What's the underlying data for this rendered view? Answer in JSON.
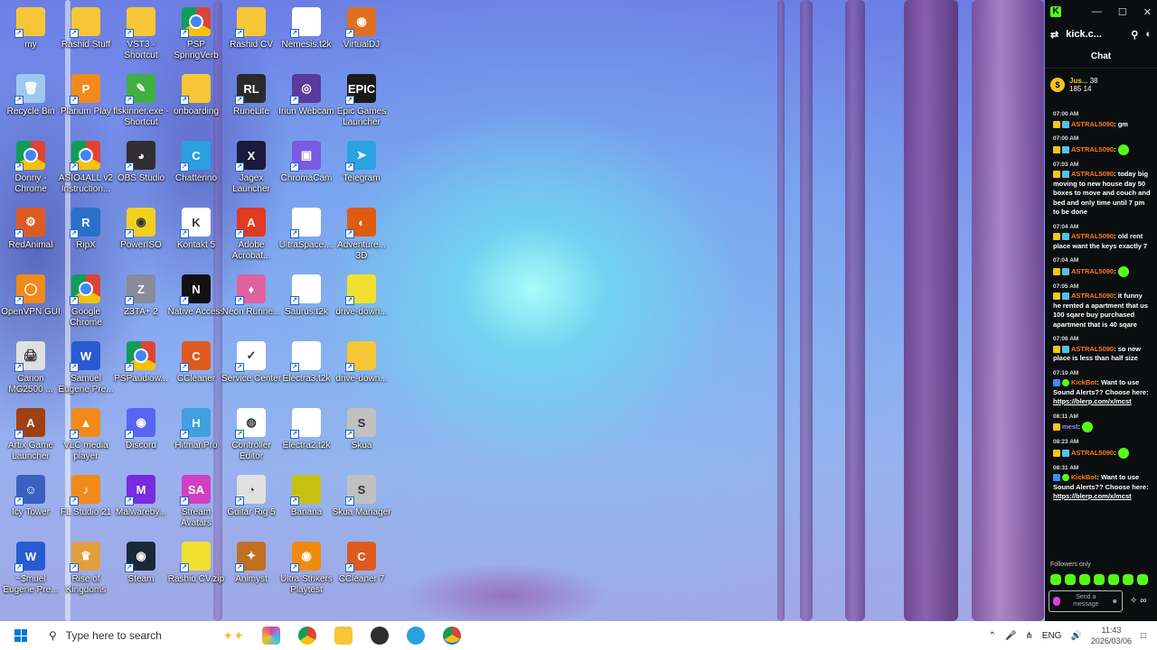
{
  "desktop": {
    "icons": [
      {
        "label": "my",
        "kind": "folder",
        "color": "#f6c636"
      },
      {
        "label": "Rashid Stuff",
        "kind": "folder",
        "color": "#f6c636"
      },
      {
        "label": "VST3 - Shortcut",
        "kind": "folder",
        "color": "#f6c636"
      },
      {
        "label": "PSP SpringVerb",
        "kind": "chrome",
        "color": "#4285f4"
      },
      {
        "label": "Rashid CV",
        "kind": "folder",
        "color": "#f6c636"
      },
      {
        "label": "Nemesis.t2k",
        "kind": "doc",
        "color": "#ffffff"
      },
      {
        "label": "VirtualDJ",
        "kind": "app",
        "color": "#e07020",
        "glyph": "◉"
      },
      {
        "label": "Recycle Bin",
        "kind": "app",
        "color": "#9fc8ee",
        "glyph": "🗑"
      },
      {
        "label": "Plarium Play",
        "kind": "app",
        "color": "#f08a1a",
        "glyph": "P"
      },
      {
        "label": "flskinner.exe - Shortcut",
        "kind": "app",
        "color": "#40b040",
        "glyph": "✎"
      },
      {
        "label": "onboarding",
        "kind": "folder",
        "color": "#f6c636"
      },
      {
        "label": "RuneLite",
        "kind": "app",
        "color": "#2a2a2a",
        "glyph": "RL"
      },
      {
        "label": "Iriun Webcam",
        "kind": "app",
        "color": "#5a3a9a",
        "glyph": "◎"
      },
      {
        "label": "Epic Games Launcher",
        "kind": "app",
        "color": "#1a1a1a",
        "glyph": "EPIC"
      },
      {
        "label": "Donny - Chrome",
        "kind": "chrome",
        "color": "#4285f4"
      },
      {
        "label": "ASIO4ALL v2 Instruction...",
        "kind": "chrome",
        "color": "#4285f4"
      },
      {
        "label": "OBS Studio",
        "kind": "app",
        "color": "#302e31",
        "glyph": "◕"
      },
      {
        "label": "Chatterino",
        "kind": "app",
        "color": "#2aa0e0",
        "glyph": "C"
      },
      {
        "label": "Jagex Launcher",
        "kind": "app",
        "color": "#1a1a3a",
        "glyph": "X"
      },
      {
        "label": "ChromaCam",
        "kind": "app",
        "color": "#7a5ae0",
        "glyph": "▣"
      },
      {
        "label": "Telegram",
        "kind": "app",
        "color": "#2aa3e0",
        "glyph": "➤"
      },
      {
        "label": "RedAnimal",
        "kind": "app",
        "color": "#e05a20",
        "glyph": "⚙"
      },
      {
        "label": "RipX",
        "kind": "app",
        "color": "#2a70c8",
        "glyph": "R"
      },
      {
        "label": "PowerISO",
        "kind": "app",
        "color": "#f2d020",
        "glyph": "◉"
      },
      {
        "label": "Kontakt 5",
        "kind": "app",
        "color": "#ffffff",
        "glyph": "K"
      },
      {
        "label": "Adobe Acrobat...",
        "kind": "app",
        "color": "#e03a20",
        "glyph": "A"
      },
      {
        "label": "UltraSpace....",
        "kind": "doc",
        "color": "#ffffff"
      },
      {
        "label": "Adventure... 3D",
        "kind": "app",
        "color": "#e05a10",
        "glyph": "◐"
      },
      {
        "label": "OpenVPN GUI",
        "kind": "app",
        "color": "#f08a1a",
        "glyph": "◯"
      },
      {
        "label": "Google Chrome",
        "kind": "chrome",
        "color": "#4285f4"
      },
      {
        "label": "Z3TA+ 2",
        "kind": "app",
        "color": "#8a8a9a",
        "glyph": "Z"
      },
      {
        "label": "Native Access",
        "kind": "app",
        "color": "#111111",
        "glyph": "N"
      },
      {
        "label": "Neon Runne...",
        "kind": "app",
        "color": "#e060a0",
        "glyph": "♦"
      },
      {
        "label": "Saurus.t2k",
        "kind": "doc",
        "color": "#ffffff"
      },
      {
        "label": "drive-down...",
        "kind": "folder",
        "color": "#f2e030"
      },
      {
        "label": "Canon MG2500 ...",
        "kind": "app",
        "color": "#e0e0e0",
        "glyph": "🖨"
      },
      {
        "label": "Samuel Eugene Pre...",
        "kind": "app",
        "color": "#2a5ad0",
        "glyph": "W"
      },
      {
        "label": "PSPaudiow...",
        "kind": "chrome",
        "color": "#4285f4"
      },
      {
        "label": "CCleaner",
        "kind": "app",
        "color": "#e05a20",
        "glyph": "C"
      },
      {
        "label": "Service Center",
        "kind": "app",
        "color": "#ffffff",
        "glyph": "✓"
      },
      {
        "label": "Electra3.t2k",
        "kind": "doc",
        "color": "#ffffff"
      },
      {
        "label": "drive-down...",
        "kind": "folder",
        "color": "#f6c636"
      },
      {
        "label": "Artix Game Launcher",
        "kind": "app",
        "color": "#a04010",
        "glyph": "A"
      },
      {
        "label": "VLC media player",
        "kind": "app",
        "color": "#f08a1a",
        "glyph": "▲"
      },
      {
        "label": "Discord",
        "kind": "app",
        "color": "#5865f2",
        "glyph": "◉"
      },
      {
        "label": "HitmanPro",
        "kind": "app",
        "color": "#40a0e0",
        "glyph": "H"
      },
      {
        "label": "Controller Editor",
        "kind": "app",
        "color": "#ffffff",
        "glyph": "◍"
      },
      {
        "label": "Electra2.t2k",
        "kind": "doc",
        "color": "#ffffff"
      },
      {
        "label": "Skua",
        "kind": "app",
        "color": "#c0c0c0",
        "glyph": "S"
      },
      {
        "label": "Icy Tower",
        "kind": "app",
        "color": "#3a60c0",
        "glyph": "☺"
      },
      {
        "label": "FL Studio 21",
        "kind": "app",
        "color": "#f08a1a",
        "glyph": "♪"
      },
      {
        "label": "Malwareby...",
        "kind": "app",
        "color": "#7a2ae0",
        "glyph": "M"
      },
      {
        "label": "Stream Avatars",
        "kind": "app",
        "color": "#d040c0",
        "glyph": "SA"
      },
      {
        "label": "Guitar Rig 5",
        "kind": "app",
        "color": "#e0e0e0",
        "glyph": "◔"
      },
      {
        "label": "Banana",
        "kind": "folder",
        "color": "#c8c010"
      },
      {
        "label": "Skua Manager",
        "kind": "app",
        "color": "#c0c0c0",
        "glyph": "S"
      },
      {
        "label": "~$muel Eugene Pre...",
        "kind": "app",
        "color": "#2a5ad0",
        "glyph": "W"
      },
      {
        "label": "Rise of Kingdoms",
        "kind": "app",
        "color": "#e0a040",
        "glyph": "♛"
      },
      {
        "label": "Steam",
        "kind": "app",
        "color": "#1b2838",
        "glyph": "◉"
      },
      {
        "label": "Rashid CV.zip",
        "kind": "folder",
        "color": "#f2e030"
      },
      {
        "label": "Animyst",
        "kind": "app",
        "color": "#c07020",
        "glyph": "✦"
      },
      {
        "label": "Ultra Strikers Playtest",
        "kind": "app",
        "color": "#f08a10",
        "glyph": "◉"
      },
      {
        "label": "CCleaner 7",
        "kind": "app",
        "color": "#e05a20",
        "glyph": "C"
      }
    ]
  },
  "chat": {
    "tab_title": "kick.c...",
    "header": "Chat",
    "pinned": {
      "name": "Jus...",
      "stat1": "38",
      "stat2": "185",
      "stat3": "14"
    },
    "messages": [
      {
        "time": "07:00 AM",
        "user": "ASTRAL5090",
        "text": "gm",
        "user_class": ""
      },
      {
        "time": "07:00 AM",
        "user": "ASTRAL5090",
        "text": "",
        "user_class": "",
        "emote": true
      },
      {
        "time": "07:03 AM",
        "user": "ASTRAL5090",
        "text": "today big moving to new house day 50 boxes to move and couch and bed and only time until 7 pm to be done",
        "user_class": ""
      },
      {
        "time": "07:04 AM",
        "user": "ASTRAL5090",
        "text": "old rent place want the keys exactly 7",
        "user_class": ""
      },
      {
        "time": "07:04 AM",
        "user": "ASTRAL5090",
        "text": "",
        "user_class": "",
        "emote": true
      },
      {
        "time": "07:05 AM",
        "user": "ASTRAL5090",
        "text": "it funny he rented a apartment that us 100 sqare buy purchased apartment that is 40 sqare",
        "user_class": ""
      },
      {
        "time": "07:06 AM",
        "user": "ASTRAL5090",
        "text": "so new place is less than half size",
        "user_class": ""
      },
      {
        "time": "07:10 AM",
        "user": "KickBot",
        "text": "Want to use Sound Alerts?? Choose here:",
        "link": "https://blerp.com/x/mcst",
        "user_class": "kb"
      },
      {
        "time": "08:11 AM",
        "user": "mest",
        "text": "",
        "user_class": "mest",
        "emote": true
      },
      {
        "time": "08:23 AM",
        "user": "ASTRAL5090",
        "text": "",
        "user_class": "",
        "emote": true
      },
      {
        "time": "08:31 AM",
        "user": "KickBot",
        "text": "Want to use Sound Alerts?? Choose here:",
        "link": "https://blerp.com/x/mcst",
        "user_class": "kb"
      }
    ],
    "followers_only": "Followers only",
    "send_placeholder": "Send a message"
  },
  "taskbar": {
    "search_placeholder": "Type here to search",
    "language": "ENG",
    "time": "11:43",
    "date": "2026/03/06"
  }
}
